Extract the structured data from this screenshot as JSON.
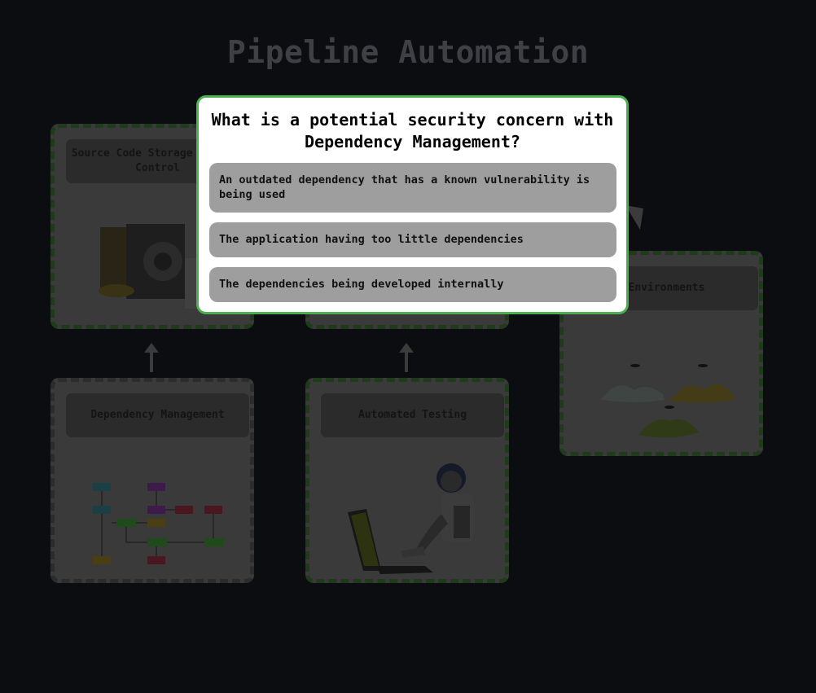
{
  "page": {
    "title": "Pipeline Automation"
  },
  "cards": {
    "source": {
      "label": "Source Code Storage Version Control"
    },
    "environments": {
      "label": "Environments"
    },
    "dependency": {
      "label": "Dependency Management"
    },
    "testing": {
      "label": "Automated Testing"
    }
  },
  "quiz": {
    "question": "What is a potential security concern with Dependency Management?",
    "answers": [
      "An outdated dependency that has a known vulnerability is being used",
      "The application having too little dependencies",
      "The dependencies being developed internally"
    ]
  },
  "colors": {
    "accent": "#4caf50",
    "background": "#0b0d11",
    "answer_bg": "#9e9e9e"
  }
}
